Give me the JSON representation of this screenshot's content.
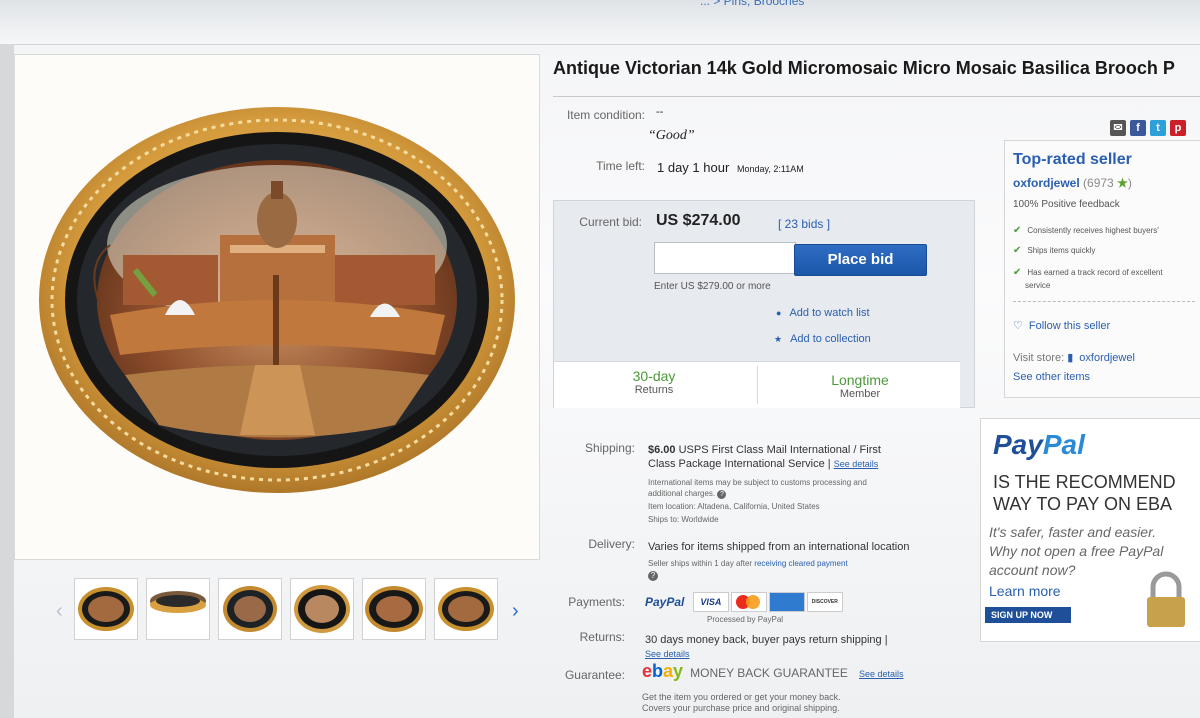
{
  "breadcrumb": "... > Pins, Brooches",
  "listing": {
    "title": "Antique Victorian 14k Gold Micromosaic Micro Mosaic Basilica Brooch P",
    "condition_label": "Item condition:",
    "condition_dash": "--",
    "condition_value": "“Good”",
    "time_left_label": "Time left:",
    "time_left_value": "1 day 1 hour",
    "time_left_end": "Monday, 2:11AM"
  },
  "bid": {
    "current_bid_label": "Current bid:",
    "current_bid_value": "US $274.00",
    "bids_count": "[ 23 bids ]",
    "input_placeholder": "",
    "place_bid_label": "Place bid",
    "enter_hint": "Enter US $279.00 or more",
    "watch_label": "Add to watch list",
    "collection_label": "Add to collection",
    "returns_big": "30-day",
    "returns_small": "Returns",
    "member_big": "Longtime",
    "member_small": "Member"
  },
  "seller": {
    "heading": "Top-rated seller",
    "name": "oxfordjewel",
    "score": "(6973",
    "feedback": "100% Positive feedback",
    "checks": [
      "Consistently receives highest buyers'",
      "Ships items quickly",
      "Has earned a track record of excellent"
    ],
    "check_extra": "service",
    "follow": "Follow this seller",
    "visit_label": "Visit store:",
    "store_name": "oxfordjewel",
    "other_items": "See other items"
  },
  "shipping": {
    "label": "Shipping:",
    "price": "$6.00",
    "method_1": "USPS First Class Mail International / First",
    "method_2": "Class Package International Service |",
    "see_details": "See details",
    "note_1": "International items may be subject to customs processing and",
    "note_2": "additional charges.",
    "location": "Item location:  Altadena, California, United States",
    "ships_to": "Ships to:  Worldwide"
  },
  "delivery": {
    "label": "Delivery:",
    "text": "Varies for items shipped from an international location",
    "note_prefix": "Seller ships within 1 day after",
    "note_link": "receiving cleared payment"
  },
  "payments": {
    "label": "Payments:",
    "paypal_pay": "PayPal",
    "paypal_pal": "",
    "cards": [
      "VISA",
      "",
      "",
      "DISCOVER"
    ],
    "processed": "Processed by PayPal"
  },
  "returns": {
    "label": "Returns:",
    "text": "30 days money back, buyer pays return shipping |",
    "see_details": "See details"
  },
  "guarantee": {
    "label": "Guarantee:",
    "ebay_e": "e",
    "ebay_b": "b",
    "ebay_a": "a",
    "ebay_y": "y",
    "mbg": "MONEY BACK GUARANTEE",
    "see_details": "See details",
    "line_1": "Get the item you ordered or get your money back.",
    "line_2": "Covers your purchase price and original shipping."
  },
  "paypal_ad": {
    "logo_pay": "Pay",
    "logo_pal": "Pal",
    "head_1": "IS THE RECOMMEND",
    "head_2": "WAY TO PAY ON EBA",
    "sub_1": "It's safer, faster and easier.",
    "sub_2": "Why not open a free PayPal",
    "sub_3": "account now?",
    "learn": "Learn more",
    "signup": "SIGN UP NOW"
  },
  "share_icons": [
    "email-icon",
    "facebook-icon",
    "twitter-icon",
    "pinterest-icon"
  ],
  "colors": {
    "link": "#2a5fb0",
    "bid_button": "#1b56a8",
    "green": "#4a9a3a",
    "paypal_dark": "#1e4f98",
    "paypal_light": "#2a8ad6"
  }
}
